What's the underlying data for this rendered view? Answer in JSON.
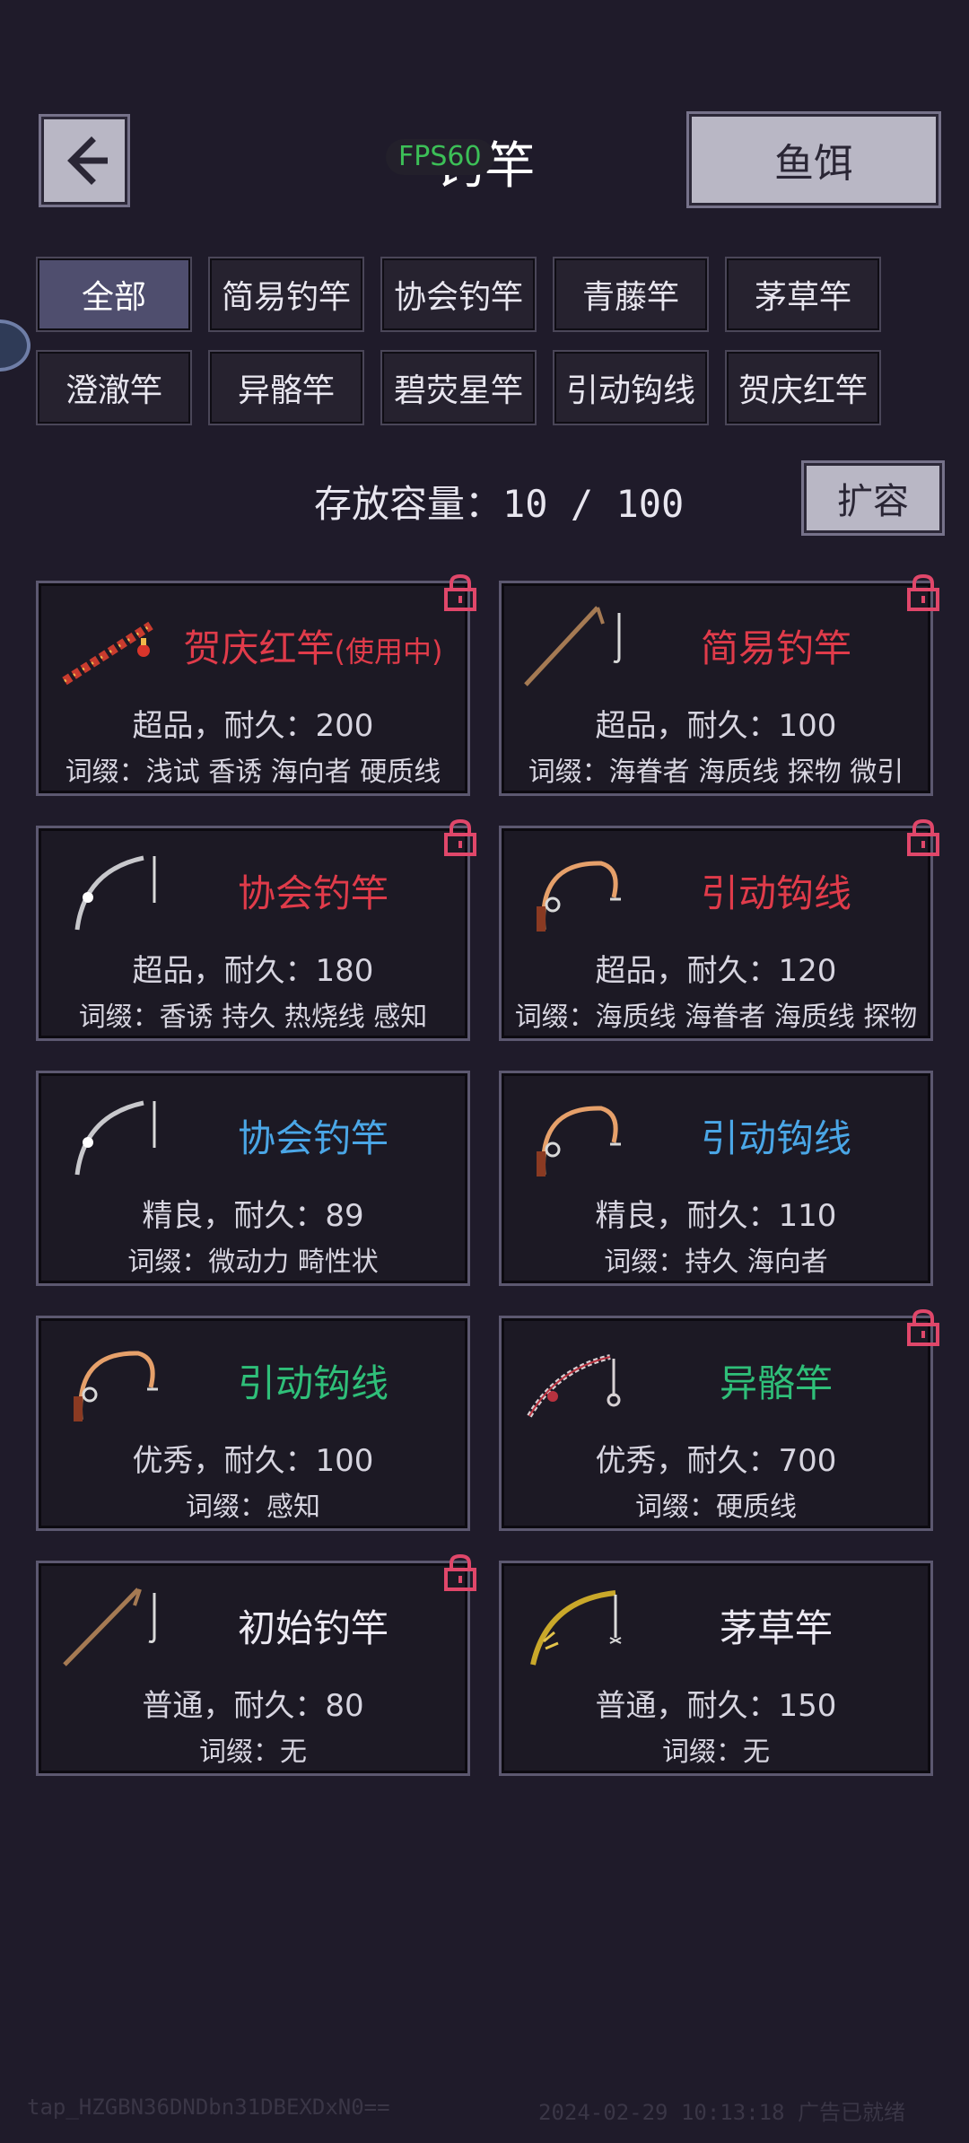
{
  "header": {
    "title": "钓竿",
    "fps": "FPS60",
    "bait_label": "鱼饵"
  },
  "filters": [
    "全部",
    "简易钓竿",
    "协会钓竿",
    "青藤竿",
    "茅草竿",
    "澄澈竿",
    "异骼竿",
    "碧荧星竿",
    "引动钩线",
    "贺庆红竿"
  ],
  "active_filter": "全部",
  "capacity": {
    "label": "存放容量：",
    "value": "10 / 100",
    "expand_label": "扩容"
  },
  "cards": [
    {
      "name": "贺庆红竿",
      "tag": "(使用中)",
      "quality": "super",
      "stats": "超品，耐久：200",
      "affix": "词缀：浅试 香诱 海向者 硬质线",
      "locked": true,
      "icon": "firecracker-rod-icon"
    },
    {
      "name": "简易钓竿",
      "tag": "",
      "quality": "super",
      "stats": "超品，耐久：100",
      "affix": "词缀：海眷者 海质线 探物 微引",
      "locked": true,
      "icon": "simple-rod-icon"
    },
    {
      "name": "协会钓竿",
      "tag": "",
      "quality": "super",
      "stats": "超品，耐久：180",
      "affix": "词缀：香诱 持久 热烧线 感知",
      "locked": true,
      "icon": "association-rod-icon"
    },
    {
      "name": "引动钩线",
      "tag": "",
      "quality": "super",
      "stats": "超品，耐久：120",
      "affix": "词缀：海质线 海眷者 海质线 探物",
      "locked": true,
      "icon": "reel-rod-icon"
    },
    {
      "name": "协会钓竿",
      "tag": "",
      "quality": "fine",
      "stats": "精良，耐久：89",
      "affix": "词缀：微动力 畸性状",
      "locked": false,
      "icon": "association-rod-icon"
    },
    {
      "name": "引动钩线",
      "tag": "",
      "quality": "fine",
      "stats": "精良，耐久：110",
      "affix": "词缀：持久 海向者",
      "locked": false,
      "icon": "reel-rod-icon"
    },
    {
      "name": "引动钩线",
      "tag": "",
      "quality": "good",
      "stats": "优秀，耐久：100",
      "affix": "词缀：感知",
      "locked": false,
      "icon": "reel-rod-icon"
    },
    {
      "name": "异骼竿",
      "tag": "",
      "quality": "good",
      "stats": "优秀，耐久：700",
      "affix": "词缀：硬质线",
      "locked": true,
      "icon": "bone-rod-icon"
    },
    {
      "name": "初始钓竿",
      "tag": "",
      "quality": "normal",
      "stats": "普通，耐久：80",
      "affix": "词缀：无",
      "locked": true,
      "icon": "starter-rod-icon"
    },
    {
      "name": "茅草竿",
      "tag": "",
      "quality": "normal",
      "stats": "普通，耐久：150",
      "affix": "词缀：无",
      "locked": false,
      "icon": "grass-rod-icon"
    }
  ],
  "footer": {
    "left": "tap_HZGBN36DNDbn31DBEXDxN0==",
    "right": "2024-02-29 10:13:18 广告已就绪"
  },
  "colors": {
    "super": "#e03b4a",
    "fine": "#4aa6e6",
    "good": "#2fbf79",
    "normal": "#ece9f2",
    "lock": "#e0476a"
  }
}
